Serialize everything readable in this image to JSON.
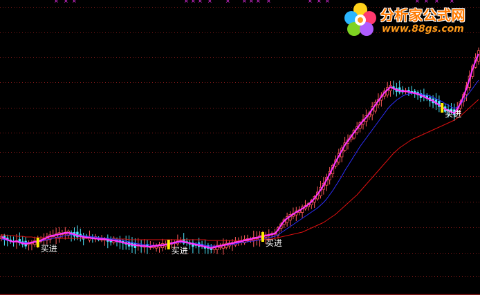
{
  "logo": {
    "title": "分析家公式网",
    "url": "www.88gs.com"
  },
  "colors": {
    "background": "#000000",
    "grid": "#8b1a1a",
    "candle_up": "#ff5a5a",
    "candle_down": "#4de8ff",
    "ma_fast": "#ff33ff",
    "ma_mid": "#2e2eff",
    "ma_slow": "#e01010",
    "signal_bar": "#ffee00",
    "buy_text": "#ffffff",
    "top_markers": "#ff33ff"
  },
  "chart_data": {
    "type": "candlestick",
    "grid": true,
    "closes": [
      343,
      345,
      347,
      349,
      350,
      349,
      351,
      352,
      353,
      352,
      351,
      350,
      350,
      348,
      346,
      344,
      342,
      341,
      340,
      339,
      338,
      337,
      337,
      338,
      339,
      341,
      342,
      343,
      344,
      344,
      345,
      345,
      346,
      346,
      346,
      347,
      348,
      348,
      349,
      350,
      351,
      352,
      353,
      354,
      355,
      355,
      356,
      356,
      357,
      357,
      356,
      356,
      355,
      355,
      354,
      353,
      352,
      351,
      350,
      349,
      350,
      351,
      352,
      353,
      354,
      355,
      356,
      357,
      358,
      359,
      358,
      357,
      356,
      355,
      354,
      353,
      352,
      351,
      350,
      349,
      348,
      347,
      346,
      345,
      344,
      343,
      342,
      341,
      340,
      339,
      338,
      333,
      326,
      320,
      316,
      313,
      310,
      307,
      305,
      302,
      299,
      296,
      292,
      287,
      281,
      275,
      268,
      260,
      252,
      243,
      234,
      226,
      218,
      210,
      204,
      198,
      192,
      186,
      180,
      175,
      170,
      165,
      158,
      152,
      146,
      140,
      134,
      130,
      126,
      128,
      130,
      131,
      132,
      132,
      133,
      134,
      135,
      136,
      138,
      140,
      142,
      144,
      146,
      149,
      152,
      155,
      158,
      160,
      162,
      164,
      158,
      150,
      140,
      128,
      115,
      100,
      88,
      78
    ],
    "ma_fast": [
      343,
      345,
      347,
      349,
      350,
      349,
      351,
      352,
      353,
      352,
      351,
      350,
      350,
      348,
      346,
      344,
      342,
      341,
      340,
      339,
      338,
      337,
      337,
      338,
      339,
      341,
      342,
      343,
      344,
      344,
      345,
      345,
      346,
      346,
      346,
      347,
      348,
      348,
      349,
      350,
      351,
      352,
      353,
      354,
      355,
      355,
      356,
      356,
      357,
      357,
      356,
      356,
      355,
      355,
      354,
      353,
      352,
      351,
      350,
      349,
      350,
      351,
      352,
      353,
      354,
      355,
      356,
      357,
      358,
      359,
      358,
      357,
      356,
      355,
      354,
      353,
      352,
      351,
      350,
      349,
      348,
      347,
      346,
      345,
      344,
      343,
      342,
      341,
      340,
      339,
      338,
      333,
      326,
      320,
      316,
      313,
      310,
      307,
      305,
      302,
      299,
      296,
      292,
      287,
      281,
      275,
      268,
      260,
      252,
      243,
      234,
      226,
      218,
      210,
      204,
      198,
      192,
      186,
      180,
      175,
      170,
      165,
      158,
      152,
      146,
      140,
      134,
      130,
      126,
      128,
      130,
      131,
      132,
      132,
      133,
      134,
      135,
      136,
      138,
      140,
      142,
      144,
      146,
      149,
      152,
      155,
      158,
      160,
      162,
      164,
      158,
      150,
      140,
      128,
      115,
      100,
      88,
      78
    ],
    "ma_mid": [
      346,
      347,
      348,
      349,
      350,
      350,
      350,
      351,
      351,
      351,
      351,
      350,
      350,
      349,
      348,
      347,
      346,
      345,
      344,
      343,
      342,
      341,
      340,
      340,
      340,
      340,
      341,
      341,
      342,
      342,
      343,
      343,
      344,
      344,
      345,
      345,
      346,
      346,
      347,
      347,
      348,
      349,
      350,
      351,
      352,
      353,
      353,
      354,
      354,
      355,
      355,
      355,
      355,
      354,
      354,
      353,
      353,
      352,
      351,
      351,
      351,
      351,
      352,
      352,
      353,
      353,
      354,
      355,
      356,
      356,
      356,
      356,
      356,
      355,
      355,
      354,
      354,
      353,
      352,
      351,
      351,
      350,
      349,
      349,
      348,
      347,
      346,
      345,
      344,
      343,
      342,
      340,
      337,
      334,
      331,
      328,
      325,
      322,
      319,
      316,
      313,
      310,
      307,
      304,
      301,
      297,
      293,
      288,
      282,
      276,
      269,
      262,
      255,
      247,
      240,
      233,
      226,
      219,
      212,
      206,
      200,
      194,
      188,
      182,
      176,
      170,
      164,
      158,
      153,
      149,
      145,
      142,
      139,
      137,
      136,
      135,
      135,
      135,
      136,
      137,
      138,
      139,
      141,
      143,
      145,
      147,
      150,
      152,
      155,
      157,
      155,
      151,
      146,
      140,
      134,
      128,
      122,
      116
    ],
    "ma_slow": [
      340,
      340,
      341,
      341,
      341,
      342,
      342,
      342,
      343,
      343,
      343,
      344,
      344,
      344,
      344,
      345,
      345,
      345,
      345,
      345,
      345,
      345,
      345,
      345,
      345,
      345,
      345,
      345,
      345,
      345,
      345,
      345,
      345,
      345,
      345,
      346,
      346,
      346,
      346,
      346,
      346,
      346,
      347,
      347,
      347,
      347,
      347,
      347,
      347,
      347,
      347,
      347,
      347,
      347,
      347,
      347,
      347,
      347,
      347,
      347,
      347,
      347,
      347,
      347,
      347,
      347,
      347,
      347,
      348,
      348,
      348,
      348,
      348,
      348,
      348,
      348,
      348,
      348,
      348,
      348,
      348,
      348,
      348,
      347,
      347,
      347,
      347,
      346,
      346,
      346,
      345,
      344,
      343,
      342,
      341,
      340,
      339,
      338,
      337,
      336,
      334,
      332,
      330,
      328,
      326,
      324,
      322,
      319,
      316,
      313,
      310,
      306,
      302,
      298,
      294,
      290,
      286,
      282,
      277,
      272,
      267,
      262,
      257,
      252,
      247,
      242,
      237,
      232,
      227,
      222,
      218,
      214,
      211,
      208,
      205,
      202,
      200,
      198,
      196,
      194,
      192,
      190,
      188,
      186,
      184,
      182,
      180,
      178,
      176,
      174,
      171,
      168,
      164,
      160,
      156,
      152,
      148,
      144
    ],
    "signals": [
      {
        "index": 12,
        "label": "买进"
      },
      {
        "index": 55,
        "label": "买进"
      },
      {
        "index": 86,
        "label": "买进"
      },
      {
        "index": 145,
        "label": "买进"
      }
    ],
    "bars_y_scale": "screen"
  }
}
